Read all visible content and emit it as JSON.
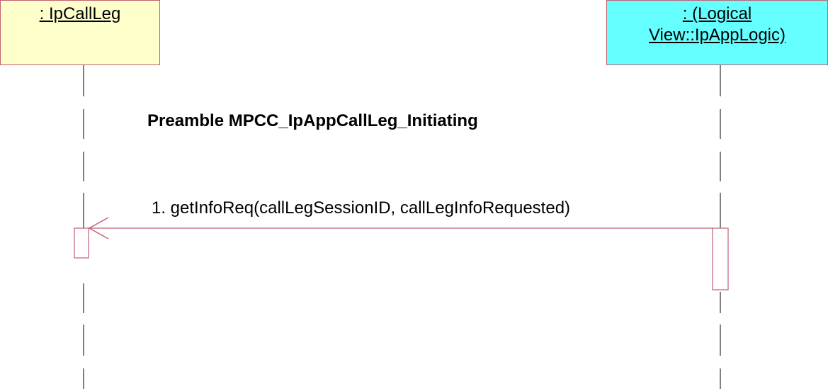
{
  "lifelines": [
    {
      "id": "left",
      "lines": [
        " : IpCallLeg"
      ],
      "fill": "#ffffcc"
    },
    {
      "id": "right",
      "lines": [
        " : (Logical",
        "View::IpAppLogic)"
      ],
      "fill": "#66ffff"
    }
  ],
  "note": {
    "text": "Preamble MPCC_IpAppCallLeg_Initiating"
  },
  "message": {
    "text": "1. getInfoReq(callLegSessionID, callLegInfoRequested)"
  },
  "colors": {
    "line": "#c06070",
    "lifeline": "#000000"
  }
}
